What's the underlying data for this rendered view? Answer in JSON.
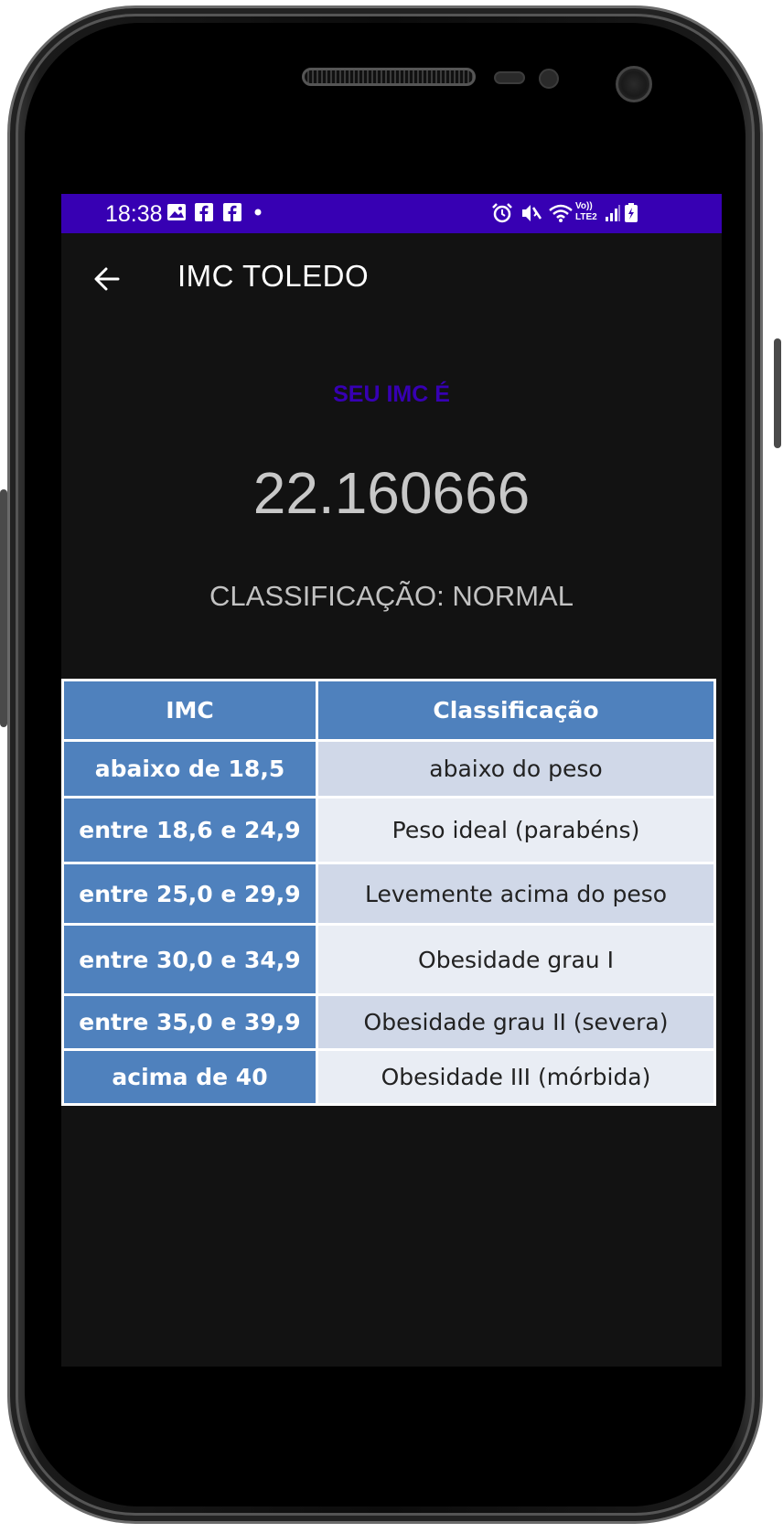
{
  "status_bar": {
    "time": "18:38",
    "network": "Vo)) LTE2",
    "left_icons": [
      "image-icon",
      "facebook-icon",
      "facebook-icon",
      "dot-icon"
    ],
    "right_icons": [
      "alarm-icon",
      "mute-icon",
      "wifi-icon",
      "signal-icon",
      "battery-icon"
    ]
  },
  "app_bar": {
    "title": "IMC TOLEDO",
    "back_icon": "arrow-left-icon"
  },
  "result": {
    "label": "SEU IMC É",
    "value": "22.160666",
    "classification": "CLASSIFICAÇÃO: NORMAL"
  },
  "table": {
    "headers": [
      "IMC",
      "Classificação"
    ],
    "rows": [
      {
        "imc": "abaixo de 18,5",
        "classificacao": "abaixo do peso"
      },
      {
        "imc": "entre 18,6 e 24,9",
        "classificacao": "Peso ideal (parabéns)"
      },
      {
        "imc": "entre 25,0 e 29,9",
        "classificacao": "Levemente acima do peso"
      },
      {
        "imc": "entre 30,0 e 34,9",
        "classificacao": "Obesidade grau I"
      },
      {
        "imc": "entre 35,0 e 39,9",
        "classificacao": "Obesidade grau II (severa)"
      },
      {
        "imc": "acima de 40",
        "classificacao": "Obesidade III (mórbida)"
      }
    ]
  },
  "colors": {
    "status_bar": "#3700b3",
    "background": "#121212",
    "accent_label": "#3700b3",
    "table_header": "#4f81bd",
    "table_row_dark": "#d0d8e8",
    "table_row_light": "#e9edf4"
  }
}
